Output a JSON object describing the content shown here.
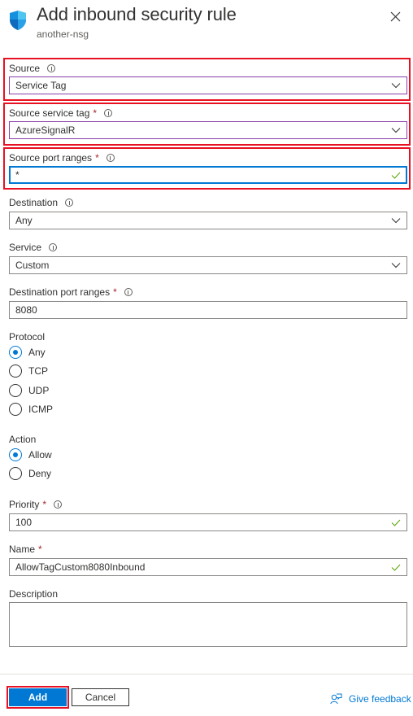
{
  "header": {
    "title": "Add inbound security rule",
    "subtitle": "another-nsg",
    "icon": "shield-icon",
    "close_icon": "close-icon"
  },
  "form": {
    "source": {
      "label": "Source",
      "value": "Service Tag",
      "required": false
    },
    "source_service_tag": {
      "label": "Source service tag",
      "value": "AzureSignalR",
      "required": true
    },
    "source_port_ranges": {
      "label": "Source port ranges",
      "value": "*",
      "required": true
    },
    "destination": {
      "label": "Destination",
      "value": "Any"
    },
    "service": {
      "label": "Service",
      "value": "Custom"
    },
    "destination_port_ranges": {
      "label": "Destination port ranges",
      "value": "8080",
      "required": true
    },
    "protocol": {
      "label": "Protocol",
      "options": [
        "Any",
        "TCP",
        "UDP",
        "ICMP"
      ],
      "selected": "Any"
    },
    "action": {
      "label": "Action",
      "options": [
        "Allow",
        "Deny"
      ],
      "selected": "Allow"
    },
    "priority": {
      "label": "Priority",
      "value": "100",
      "required": true
    },
    "name": {
      "label": "Name",
      "value": "AllowTagCustom8080Inbound",
      "required": true
    },
    "description": {
      "label": "Description",
      "value": ""
    },
    "required_marker": "*"
  },
  "footer": {
    "add_label": "Add",
    "cancel_label": "Cancel",
    "feedback_label": "Give feedback"
  },
  "colors": {
    "accent": "#0078d4",
    "highlight": "#e81123",
    "required": "#a4262c",
    "valid_check": "#57a300",
    "dropdown_border": "#8a3fa8"
  }
}
